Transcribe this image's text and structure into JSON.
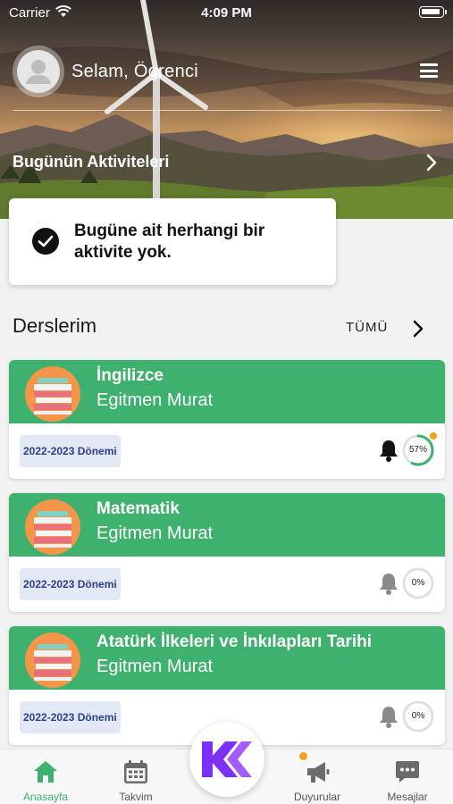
{
  "status_bar": {
    "carrier": "Carrier",
    "time": "4:09 PM"
  },
  "header": {
    "greeting": "Selam, Ögrenci",
    "activities_title": "Bugünün Aktiviteleri",
    "no_activity_message": "Bugüne ait herhangi bir aktivite yok."
  },
  "courses_section": {
    "title": "Derslerim",
    "see_all_label": "TÜMÜ",
    "items": [
      {
        "name": "İngilizce",
        "teacher": "Egitmen Murat",
        "term": "2022-2023 Dönemi",
        "progress_label": "57%",
        "progress": 57,
        "has_notification": true
      },
      {
        "name": "Matematik",
        "teacher": "Egitmen Murat",
        "term": "2022-2023 Dönemi",
        "progress_label": "0%",
        "progress": 0,
        "has_notification": false
      },
      {
        "name": "Atatürk İlkeleri ve İnkılapları Tarihi",
        "teacher": "Egitmen Murat",
        "term": "2022-2023 Dönemi",
        "progress_label": "0%",
        "progress": 0,
        "has_notification": false
      }
    ]
  },
  "tab_bar": {
    "items": [
      {
        "label": "Anasayfa",
        "icon": "home-icon",
        "active": true
      },
      {
        "label": "Takvim",
        "icon": "calendar-icon",
        "active": false
      },
      {
        "label": "Duyurular",
        "icon": "megaphone-icon",
        "active": false,
        "has_badge": true
      },
      {
        "label": "Mesajlar",
        "icon": "chat-icon",
        "active": false
      }
    ],
    "center_logo": "K-logo"
  },
  "colors": {
    "accent_green": "#3db16d",
    "progress_ring": "#3db16d",
    "badge_orange": "#f0a31a",
    "logo_purple": "#7b2ff7",
    "term_text": "#2b3f8c"
  }
}
